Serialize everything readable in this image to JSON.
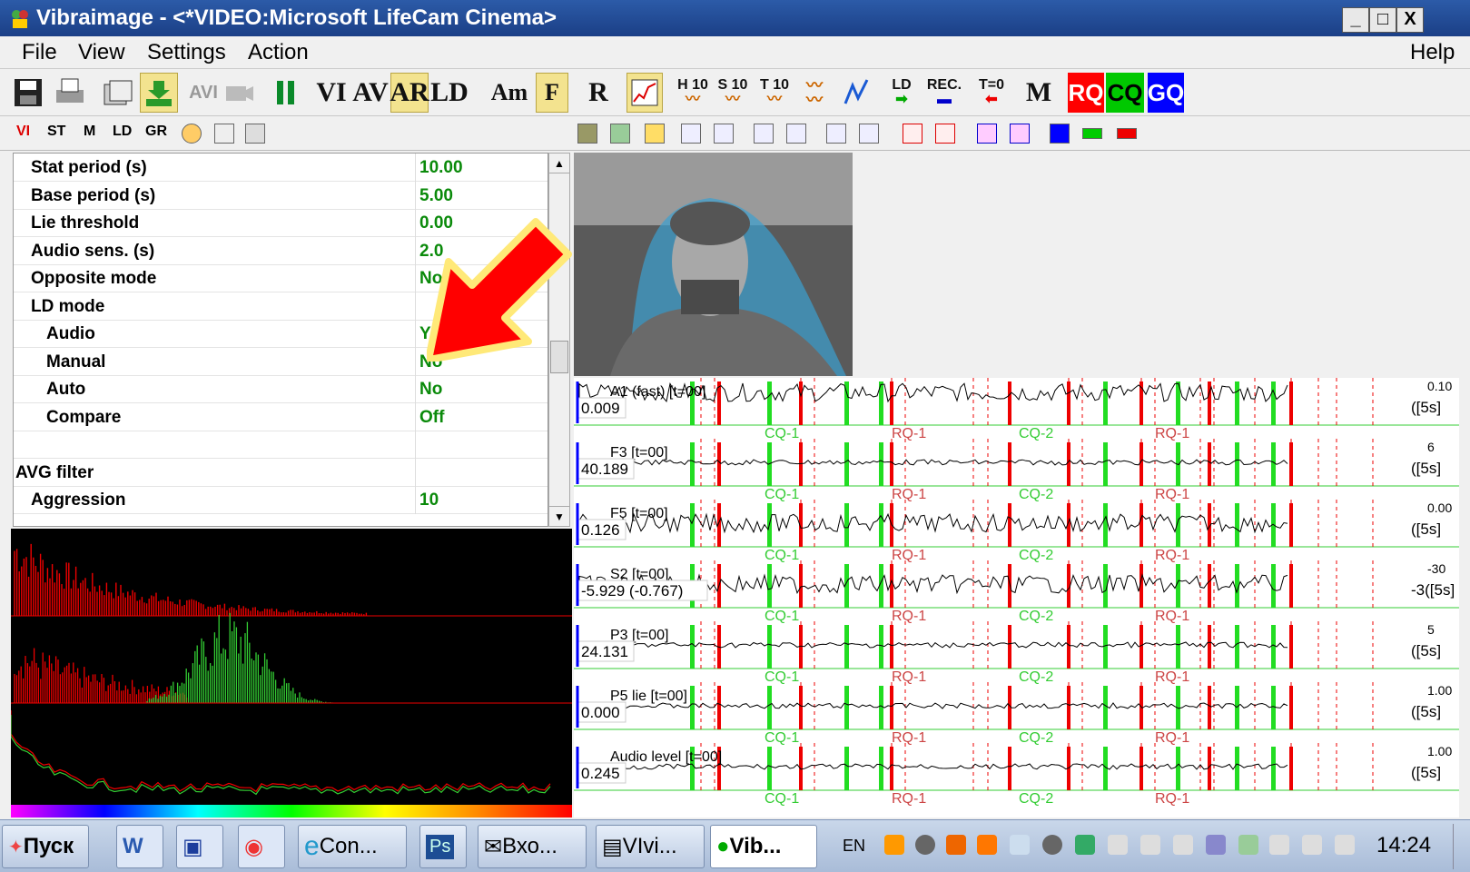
{
  "window": {
    "title": "Vibraimage - <*VIDEO:Microsoft LifeCam Cinema>",
    "btn_min": "_",
    "btn_max": "□",
    "btn_close": "X"
  },
  "menu": {
    "file": "File",
    "view": "View",
    "settings": "Settings",
    "action": "Action",
    "help": "Help"
  },
  "toolbar": {
    "avi": "AVI",
    "vi": "VI",
    "av": "AV",
    "ar": "AR",
    "ld": "LD",
    "am": "Am",
    "f": "F",
    "r": "R",
    "h10": "H 10",
    "s10": "S 10",
    "t10": "T 10",
    "ld_small": "LD",
    "rec": "REC.",
    "t0": "T=0",
    "m": "M",
    "rq": "RQ",
    "cq": "CQ",
    "gq": "GQ"
  },
  "toolbar2": {
    "vi": "VI",
    "st": "ST",
    "m": "M",
    "ld": "LD",
    "gr": "GR"
  },
  "props": [
    {
      "k": "Stat period (s)",
      "v": "10.00",
      "indent": 1
    },
    {
      "k": "Base period (s)",
      "v": "5.00",
      "indent": 1
    },
    {
      "k": "Lie threshold",
      "v": "0.00",
      "indent": 1
    },
    {
      "k": "Audio sens. (s)",
      "v": "2.0",
      "indent": 1
    },
    {
      "k": "Opposite mode",
      "v": "No",
      "indent": 1
    },
    {
      "k": "LD mode",
      "v": "",
      "indent": 1
    },
    {
      "k": "Audio",
      "v": "Y",
      "indent": 2
    },
    {
      "k": "Manual",
      "v": "No",
      "indent": 2
    },
    {
      "k": "Auto",
      "v": "No",
      "indent": 2
    },
    {
      "k": "Compare",
      "v": "Off",
      "indent": 2
    },
    {
      "k": "",
      "v": "",
      "indent": 0
    },
    {
      "k": "AVG filter",
      "v": "",
      "indent": 0
    },
    {
      "k": "Aggression",
      "v": "10",
      "indent": 1
    }
  ],
  "graphs": [
    {
      "label": "A1 (fast) [t=00]",
      "value": "0.009",
      "right_top": "0.10",
      "right": "([5s]"
    },
    {
      "label": "F3 [t=00]",
      "value": "40.189",
      "right_top": "6",
      "right": "([5s]"
    },
    {
      "label": "F5 [t=00]",
      "value": "0.126",
      "right_top": "0.00",
      "right": "([5s]"
    },
    {
      "label": "S2 [t=00]",
      "value": "-5.929 (-0.767)",
      "right_top": "-30",
      "right": "-3([5s]"
    },
    {
      "label": "P3 [t=00]",
      "value": "24.131",
      "right_top": "5",
      "right": "([5s]"
    },
    {
      "label": "P5 lie [t=00]",
      "value": "0.000",
      "right_top": "1.00",
      "right": "([5s]"
    },
    {
      "label": "Audio level [t=00]",
      "value": "0.245",
      "right_top": "1.00",
      "right": "([5s]"
    }
  ],
  "markers": {
    "cq1": "CQ-1",
    "rq1": "RQ-1",
    "cq2": "CQ-2",
    "rq1b": "RQ-1"
  },
  "taskbar": {
    "start": "Пуск",
    "con": "Con...",
    "vxo": "Вхо...",
    "vivi": "VIvi...",
    "vib": "Vib...",
    "lang": "EN",
    "clock": "14:24"
  },
  "colors": {
    "title": "#1b3f86",
    "green_value": "#0a8a0a",
    "rq": "#ff0000",
    "cq": "#00c800",
    "gq": "#0000ff"
  }
}
